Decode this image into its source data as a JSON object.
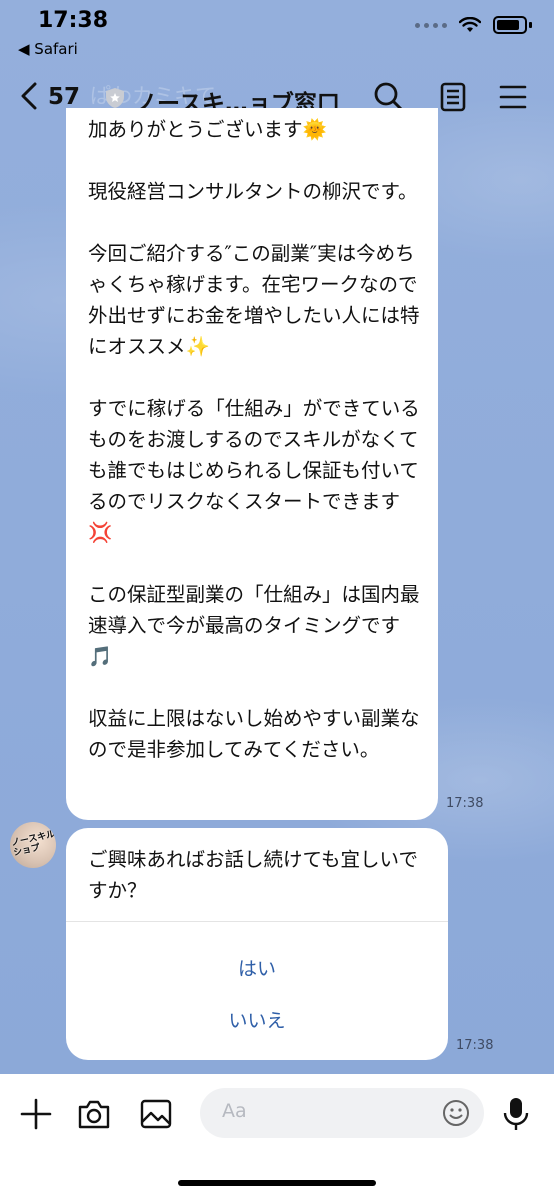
{
  "status_bar": {
    "time": "17:38",
    "back_app": "◀ Safari"
  },
  "header": {
    "unread_count": "57",
    "title": "ノースキ…ョブ窓口",
    "ghost_text": "ぱわカミキて",
    "icons": [
      "back-chevron-icon",
      "shield-icon",
      "search-icon",
      "notes-icon",
      "menu-icon"
    ]
  },
  "messages": [
    {
      "text": "加ありがとうございます🌞\n\n現役経営コンサルタントの柳沢です。\n\n今回ご紹介する″この副業″実は今めちゃくちゃ稼げます。在宅ワークなので外出せずにお金を増やしたい人には特にオススメ✨\n\nすでに稼げる「仕組み」ができているものをお渡しするのでスキルがなくても誰でもはじめられるし保証も付いてるのでリスクなくスタートできます💢\n\nこの保証型副業の「仕組み」は国内最速導入で今が最高のタイミングです🎵\n\n収益に上限はないし始めやすい副業なので是非参加してみてください。",
      "time": "17:38"
    },
    {
      "sender_avatar_text": "ノースキル\nショプ",
      "text": "ご興味あればお話し続けても宜しいですか？",
      "choices": [
        "はい",
        "いいえ"
      ],
      "time": "17:38"
    }
  ],
  "input_bar": {
    "placeholder": "Aa",
    "icons": [
      "plus-icon",
      "camera-icon",
      "image-icon",
      "emoji-icon",
      "microphone-icon"
    ]
  },
  "colors": {
    "background": "#8fabd9",
    "choice_text": "#2f5fa8",
    "bubble": "#ffffff"
  }
}
